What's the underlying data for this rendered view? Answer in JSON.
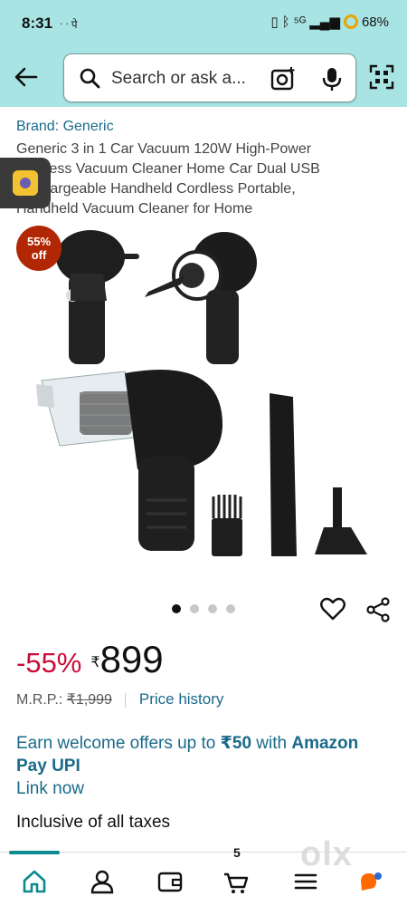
{
  "status_bar": {
    "time": "8:31",
    "extra": "ᐧ ᐧ पे",
    "network": "⁵ᴳ",
    "battery": "68%"
  },
  "header": {
    "search_placeholder": "Search or ask a..."
  },
  "product": {
    "brand": "Brand: Generic",
    "title": "Generic 3 in 1 Car Vacuum 120W High-Power Wireless Vacuum Cleaner Home Car Dual USB Rechargeable Handheld Cordless Portable, Handheld Vacuum Cleaner for Home",
    "badge_pct": "55%",
    "badge_off": "off",
    "image_count": 4,
    "active_image": 0
  },
  "pricing": {
    "discount": "-55%",
    "currency": "₹",
    "price": "899",
    "mrp_label": "M.R.P.:",
    "mrp_value": "₹1,999",
    "price_history": "Price history"
  },
  "offer": {
    "prefix": "Earn welcome offers up to ",
    "amount": "₹50",
    "middle": " with ",
    "brand": "Amazon Pay UPI",
    "link": "Link now"
  },
  "taxes": "Inclusive of all taxes",
  "bottom_nav": {
    "items": [
      "home-icon",
      "account-icon",
      "wallet-icon",
      "cart-icon",
      "menu-icon",
      "rufus-icon"
    ],
    "cart_count": "5"
  },
  "watermark": "olx",
  "colors": {
    "header_bg": "#a9e4e4",
    "link": "#1a6a8a",
    "discount_red": "#cc0c39",
    "badge_red": "#b12704",
    "nav_accent": "#0b8a8f"
  }
}
